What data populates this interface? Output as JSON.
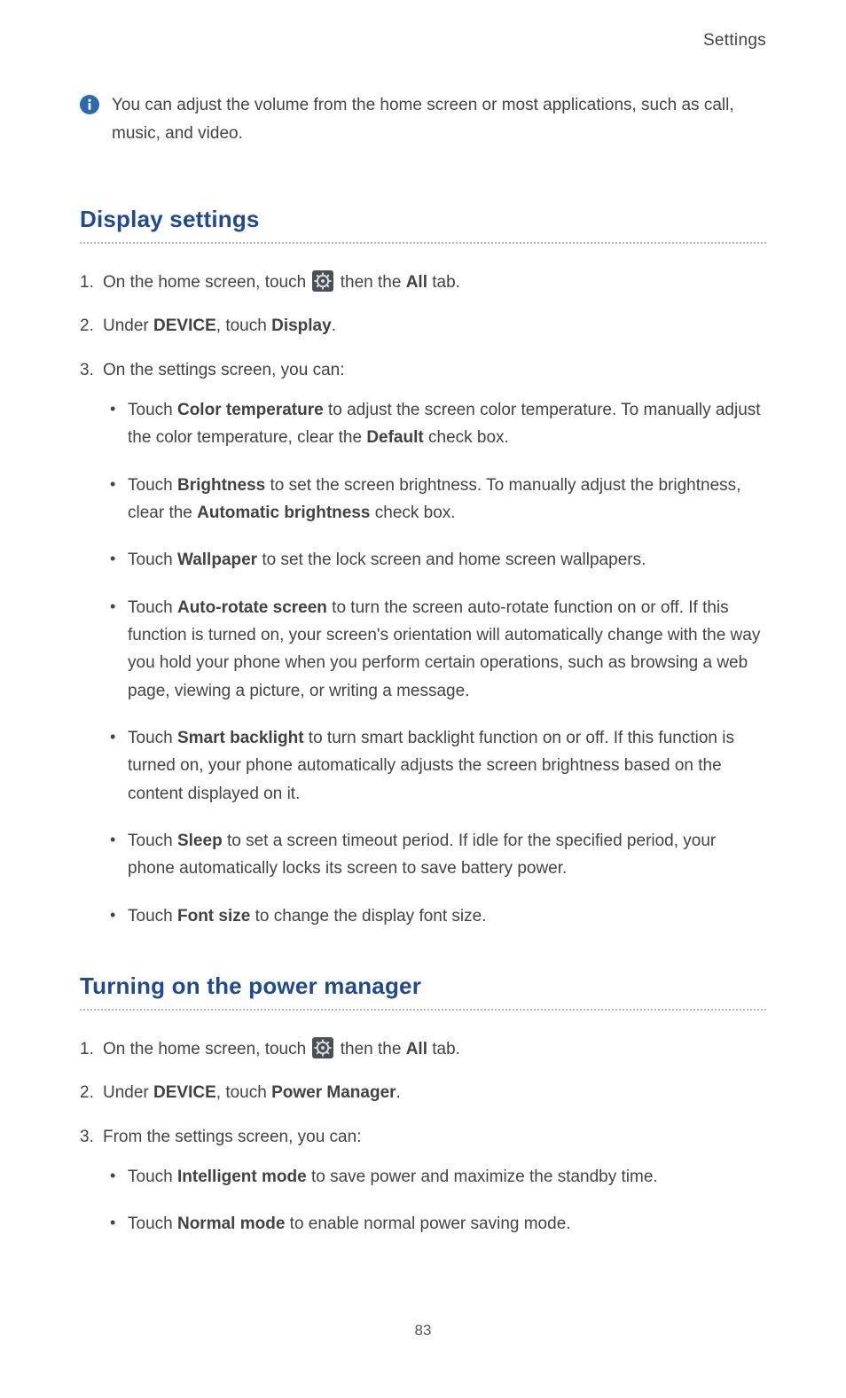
{
  "header": {
    "label": "Settings"
  },
  "info": {
    "text": "You can adjust the volume from the home screen or most applications, such as call, music, and video."
  },
  "section_display": {
    "heading": "Display settings",
    "step1_a": "On the home screen, touch ",
    "step1_b": " then the ",
    "step1_all": "All",
    "step1_c": " tab.",
    "step2_a": "Under ",
    "step2_device": "DEVICE",
    "step2_b": ", touch ",
    "step2_display": "Display",
    "step2_c": ".",
    "step3_a": "On the settings screen, you can:",
    "bullets": {
      "b1_a": "Touch ",
      "b1_bold": "Color temperature",
      "b1_b": " to adjust the screen color temperature. To manually adjust the color temperature, clear the ",
      "b1_bold2": "Default",
      "b1_c": " check box.",
      "b2_a": "Touch ",
      "b2_bold": "Brightness",
      "b2_b": " to set the screen brightness. To manually adjust the brightness, clear the ",
      "b2_bold2": "Automatic brightness",
      "b2_c": " check box.",
      "b3_a": "Touch ",
      "b3_bold": "Wallpaper",
      "b3_b": " to set the lock screen and home screen wallpapers.",
      "b4_a": "Touch ",
      "b4_bold": "Auto-rotate screen",
      "b4_b": " to turn the screen auto-rotate function on or off. If this function is turned on, your screen's orientation will automatically change with the way you hold your phone when you perform certain operations, such as browsing a web page, viewing a picture, or writing a message.",
      "b5_a": "Touch ",
      "b5_bold": "Smart backlight",
      "b5_b": " to turn smart backlight function on or off. If this function is turned on, your phone automatically adjusts the screen brightness based on the content displayed on it.",
      "b6_a": "Touch ",
      "b6_bold": "Sleep",
      "b6_b": " to set a screen timeout period. If idle for the specified period, your phone automatically locks its screen to save battery power.",
      "b7_a": "Touch ",
      "b7_bold": "Font size",
      "b7_b": " to change the display font size."
    }
  },
  "section_power": {
    "heading": "Turning on the power manager",
    "step1_a": "On the home screen, touch ",
    "step1_b": " then the ",
    "step1_all": "All",
    "step1_c": " tab.",
    "step2_a": "Under ",
    "step2_device": "DEVICE",
    "step2_b": ", touch ",
    "step2_pm": "Power Manager",
    "step2_c": ".",
    "step3_a": "From the settings screen, you can:",
    "bullets": {
      "b1_a": "Touch ",
      "b1_bold": "Intelligent mode",
      "b1_b": " to save power and maximize the standby time.",
      "b2_a": "Touch ",
      "b2_bold": "Normal mode",
      "b2_b": " to enable normal power saving mode."
    }
  },
  "page_number": "83"
}
